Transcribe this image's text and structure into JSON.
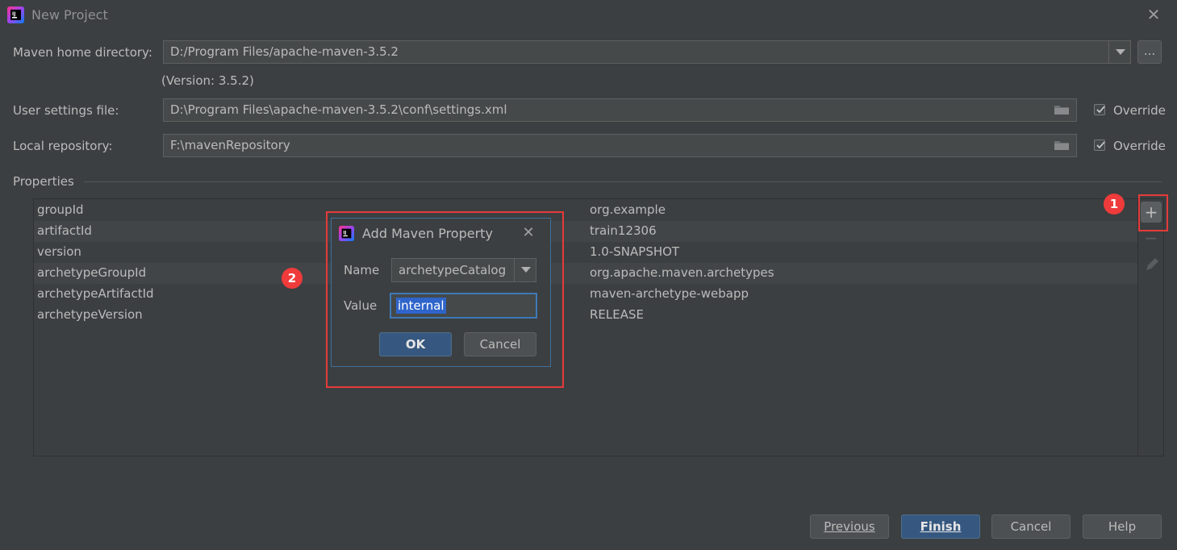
{
  "window": {
    "title": "New Project",
    "close_label": "✕"
  },
  "maven_home": {
    "label": "Maven home directory:",
    "value": "D:/Program Files/apache-maven-3.5.2",
    "browse_label": "...",
    "version_text": "(Version: 3.5.2)"
  },
  "user_settings": {
    "label": "User settings file:",
    "value": "D:\\Program Files\\apache-maven-3.5.2\\conf\\settings.xml",
    "override_label": "Override",
    "override_checked": true
  },
  "local_repo": {
    "label": "Local repository:",
    "value": "F:\\mavenRepository",
    "override_label": "Override",
    "override_checked": true
  },
  "properties": {
    "section_title": "Properties",
    "rows": [
      {
        "key": "groupId",
        "value": "org.example"
      },
      {
        "key": "artifactId",
        "value": "train12306"
      },
      {
        "key": "version",
        "value": "1.0-SNAPSHOT"
      },
      {
        "key": "archetypeGroupId",
        "value": "org.apache.maven.archetypes"
      },
      {
        "key": "archetypeArtifactId",
        "value": "maven-archetype-webapp"
      },
      {
        "key": "archetypeVersion",
        "value": "RELEASE"
      }
    ],
    "add_label": "+",
    "remove_label": "−"
  },
  "annotations": {
    "badge1": "1",
    "badge2": "2",
    "highlight_color": "#e53b3b"
  },
  "dialog": {
    "title": "Add Maven Property",
    "close_label": "✕",
    "name_label": "Name",
    "name_value": "archetypeCatalog",
    "value_label": "Value",
    "value_value": "internal",
    "ok_label": "OK",
    "cancel_label": "Cancel"
  },
  "footer": {
    "previous_label": "Previous",
    "finish_label": "Finish",
    "cancel_label": "Cancel",
    "help_label": "Help"
  },
  "colors": {
    "background": "#3c3f41",
    "primary_button": "#365880",
    "selection": "#2f65ca"
  }
}
